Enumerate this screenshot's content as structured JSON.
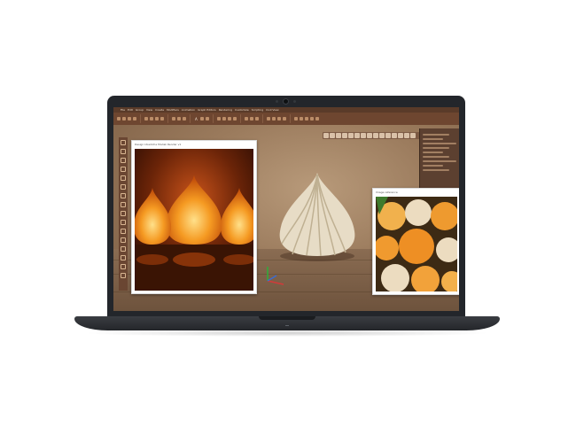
{
  "menu": {
    "items": [
      "File",
      "Edit",
      "Group",
      "View",
      "Create",
      "Modifiers",
      "Animation",
      "Graph Editors",
      "Rendering",
      "Customize",
      "Scripting",
      "Civil View"
    ]
  },
  "ribbon": {
    "label": "A"
  },
  "left_window": {
    "title": "Design Ukadiche Modak Render v1"
  },
  "right_window": {
    "title": "Image reference"
  },
  "colors": {
    "bezel": "#23262b",
    "app_bar": "#5a3b29",
    "ribbon": "#6e4630",
    "viewport": "#9a7a5c",
    "lamp_glow": "#f39a1e",
    "modak_cream": "#e7dcc6",
    "modak_orange": "#ee9a2f"
  },
  "icons": [
    "webcam-icon",
    "menu-icon",
    "tool-icon",
    "axis-gizmo-icon"
  ]
}
